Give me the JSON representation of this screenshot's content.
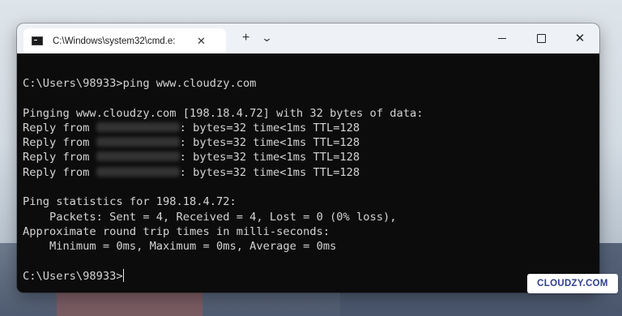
{
  "window": {
    "tab_title": "C:\\Windows\\system32\\cmd.e:",
    "tab_close": "✕",
    "new_tab": "+",
    "tab_menu": "⌄",
    "close_glyph": "✕"
  },
  "console": {
    "prompt_cmd": "C:\\Users\\98933>ping www.cloudzy.com",
    "pinging": "Pinging www.cloudzy.com [198.18.4.72] with 32 bytes of data:",
    "replies": [
      {
        "prefix": "Reply from ",
        "suffix": ": bytes=32 time<1ms TTL=128"
      },
      {
        "prefix": "Reply from ",
        "suffix": ": bytes=32 time<1ms TTL=128"
      },
      {
        "prefix": "Reply from ",
        "suffix": ": bytes=32 time<1ms TTL=128"
      },
      {
        "prefix": "Reply from ",
        "suffix": ": bytes=32 time<1ms TTL=128"
      }
    ],
    "stats_header": "Ping statistics for 198.18.4.72:",
    "packets": "    Packets: Sent = 4, Received = 4, Lost = 0 (0% loss),",
    "rtt_header": "Approximate round trip times in milli-seconds:",
    "rtt_values": "    Minimum = 0ms, Maximum = 0ms, Average = 0ms",
    "prompt_final": "C:\\Users\\98933>"
  },
  "watermark": "CLOUDZY.COM",
  "colors": {
    "console_bg": "#0c0c0c",
    "console_text": "#d4d4d4",
    "titlebar_bg": "#eef1f5",
    "watermark_text": "#2d3f8e"
  }
}
